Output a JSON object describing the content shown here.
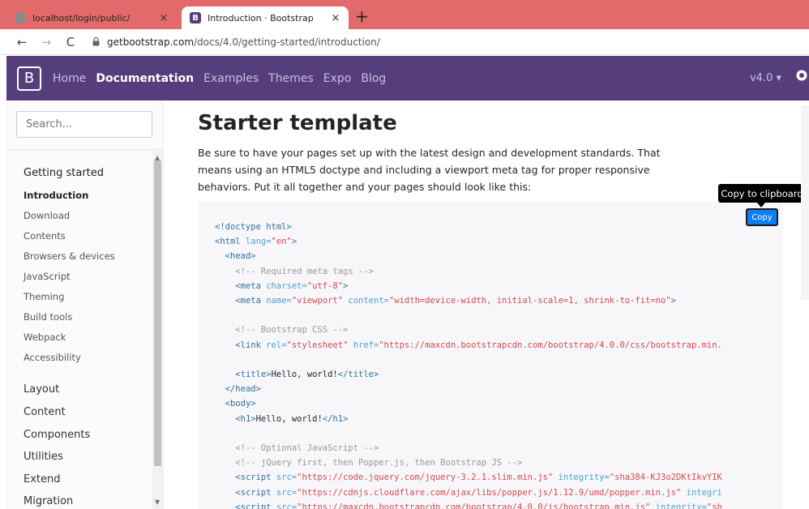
{
  "browser": {
    "tabs": [
      {
        "title": "localhost/login/public/",
        "favicon": "globe-icon",
        "active": false
      },
      {
        "title": "Introduction · Bootstrap",
        "favicon": "bootstrap-icon",
        "active": true
      }
    ],
    "close_glyph": "×",
    "newtab_glyph": "+",
    "back_glyph": "←",
    "forward_glyph": "→",
    "reload_glyph": "C",
    "url_domain": "getbootstrap.com",
    "url_path": "/docs/4.0/getting-started/introduction/"
  },
  "navbar": {
    "brand": "B",
    "links": [
      "Home",
      "Documentation",
      "Examples",
      "Themes",
      "Expo",
      "Blog"
    ],
    "active_link": "Documentation",
    "version": "v4.0 ▾"
  },
  "sidebar": {
    "search_placeholder": "Search...",
    "groups": [
      {
        "title": "Getting started",
        "items": [
          "Introduction",
          "Download",
          "Contents",
          "Browsers & devices",
          "JavaScript",
          "Theming",
          "Build tools",
          "Webpack",
          "Accessibility"
        ],
        "active_item": "Introduction"
      },
      {
        "title": "Layout"
      },
      {
        "title": "Content"
      },
      {
        "title": "Components"
      },
      {
        "title": "Utilities"
      },
      {
        "title": "Extend"
      },
      {
        "title": "Migration"
      }
    ],
    "scroll_up_glyph": "▲",
    "scroll_down_glyph": "▼"
  },
  "main": {
    "title": "Starter template",
    "lead": "Be sure to have your pages set up with the latest design and development standards. That means using an HTML5 doctype and including a viewport meta tag for proper responsive behaviors. Put it all together and your pages should look like this:",
    "tooltip": "Copy to clipboard",
    "copy_label": "Copy"
  },
  "code": {
    "l1": "<!doctype html>",
    "l2_open": "<html ",
    "l2_attr": "lang=",
    "l2_val": "\"en\"",
    "l2_close": ">",
    "l3": "<head>",
    "l4": "<!-- Required meta tags -->",
    "l5_open": "<meta ",
    "l5_attr": "charset=",
    "l5_val": "\"utf-8\"",
    "l5_close": ">",
    "l6_open": "<meta ",
    "l6_attr1": "name=",
    "l6_val1": "\"viewport\"",
    "l6_attr2": " content=",
    "l6_val2": "\"width=device-width, initial-scale=1, shrink-to-fit=no\"",
    "l6_close": ">",
    "l8": "<!-- Bootstrap CSS -->",
    "l9_open": "<link ",
    "l9_attr1": "rel=",
    "l9_val1": "\"stylesheet\"",
    "l9_attr2": " href=",
    "l9_val2": "\"https://maxcdn.bootstrapcdn.com/bootstrap/4.0.0/css/bootstrap.min.",
    "l11_open": "<title>",
    "l11_text": "Hello, world!",
    "l11_close": "</title>",
    "l12": "</head>",
    "l13": "<body>",
    "l14_open": "<h1>",
    "l14_text": "Hello, world!",
    "l14_close": "</h1>",
    "l16": "<!-- Optional JavaScript -->",
    "l17": "<!-- jQuery first, then Popper.js, then Bootstrap JS -->",
    "l18_open": "<script ",
    "l18_attr1": "src=",
    "l18_val1": "\"https://code.jquery.com/jquery-3.2.1.slim.min.js\"",
    "l18_attr2": " integrity=",
    "l18_val2": "\"sha384-KJ3o2DKtIkvYIK",
    "l19_open": "<script ",
    "l19_attr1": "src=",
    "l19_val1": "\"https://cdnjs.cloudflare.com/ajax/libs/popper.js/1.12.9/umd/popper.min.js\"",
    "l19_attr2": " integri",
    "l20_open": "<script ",
    "l20_attr1": "src=",
    "l20_val1": "\"https://maxcdn.bootstrapcdn.com/bootstrap/4.0.0/js/bootstrap.min.js\"",
    "l20_attr2": " integrity=",
    "l20_val2": "\"sh"
  }
}
